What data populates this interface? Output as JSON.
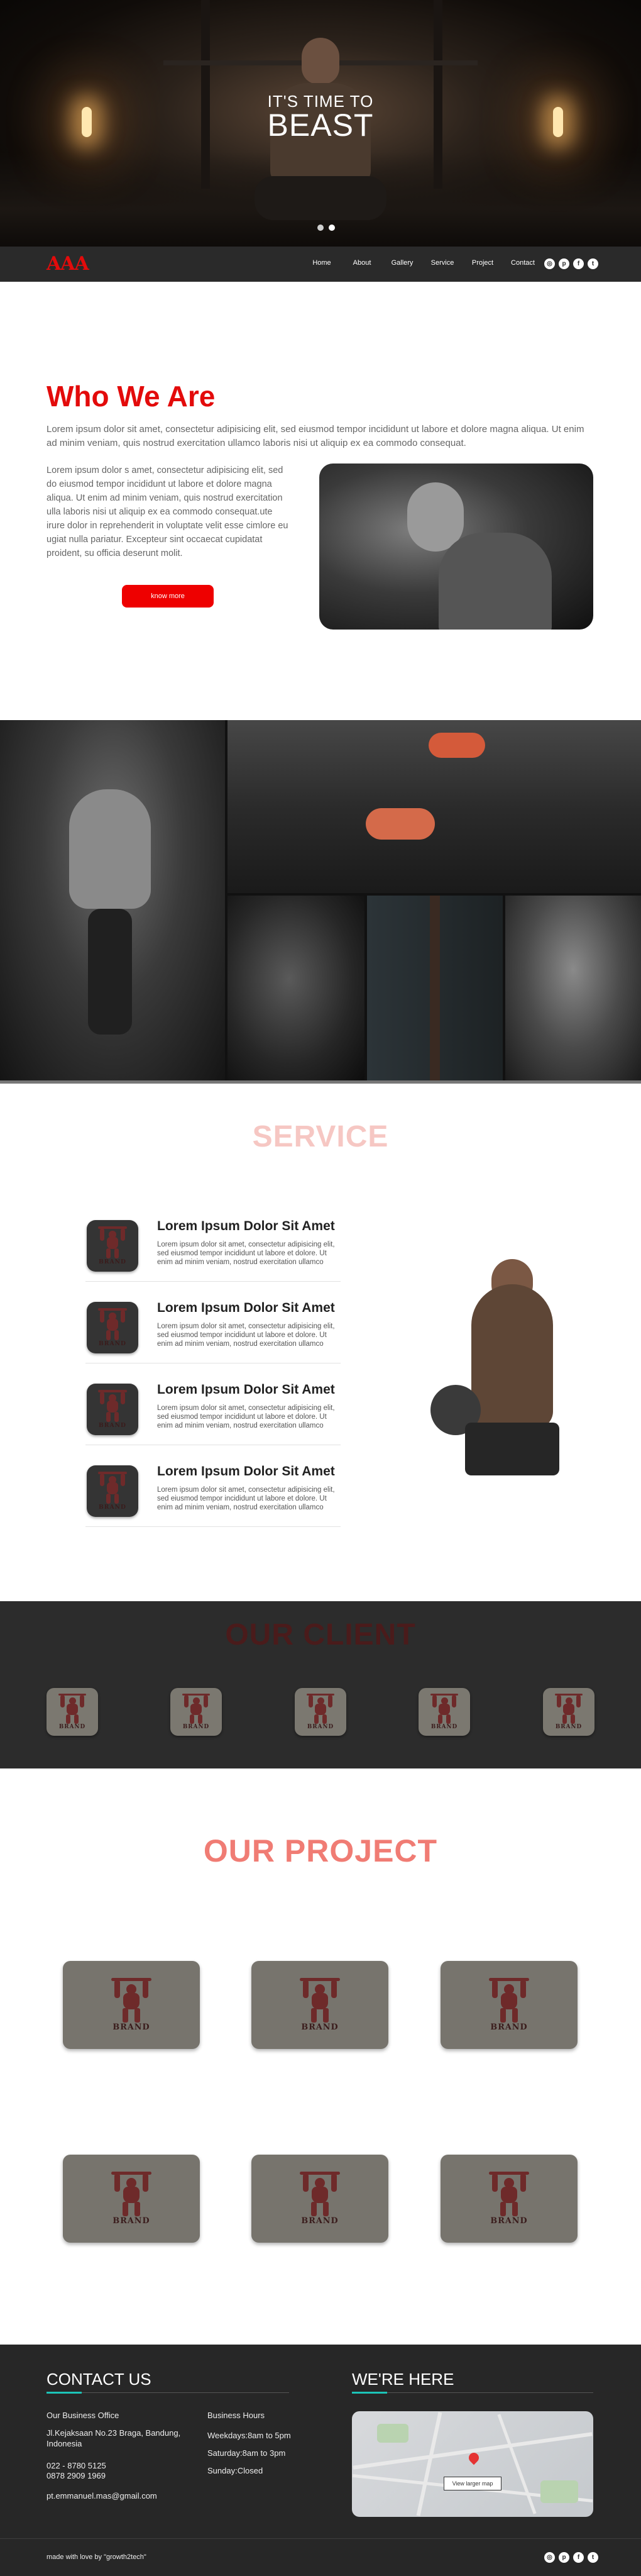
{
  "hero": {
    "subtitle": "IT'S TIME TO",
    "title": "BEAST",
    "slides": 2,
    "active_slide": 2
  },
  "nav": {
    "logo": "AAA",
    "items": [
      "Home",
      "About",
      "Gallery",
      "Service",
      "Project",
      "Contact"
    ],
    "social_icons": [
      "dribbble-icon",
      "pinterest-icon",
      "facebook-icon",
      "twitter-icon"
    ]
  },
  "who": {
    "title": "Who We Are",
    "intro": "Lorem ipsum dolor sit amet, consectetur adipisicing elit, sed eiusmod tempor incididunt ut labore et dolore magna aliqua. Ut enim ad minim veniam, quis nostrud exercitation ullamco laboris nisi ut aliquip ex ea commodo consequat.",
    "body": "Lorem ipsum dolor s amet, consectetur adipisicing elit, sed do eiusmod tempor incididunt ut labore et dolore magna aliqua. Ut enim ad minim veniam, quis nostrud exercitation ulla laboris nisi ut aliquip ex ea commodo consequat.ute irure dolor in reprehenderit in voluptate velit esse cimlore eu ugiat nulla pariatur. Excepteur sint occaecat cupidatat proident, su officia deserunt molit.",
    "button_label": "know more"
  },
  "service": {
    "title": "SERVICE",
    "items": [
      {
        "heading": "Lorem Ipsum Dolor Sit Amet",
        "desc": "Lorem ipsum dolor sit amet, consectetur adipisicing elit, sed eiusmod tempor incididunt ut labore et dolore. Ut enim ad minim veniam, nostrud exercitation ullamco"
      },
      {
        "heading": "Lorem Ipsum Dolor Sit Amet",
        "desc": "Lorem ipsum dolor sit amet, consectetur adipisicing elit, sed eiusmod tempor incididunt ut labore et dolore. Ut enim ad minim veniam, nostrud exercitation ullamco"
      },
      {
        "heading": "Lorem Ipsum Dolor Sit Amet",
        "desc": "Lorem ipsum dolor sit amet, consectetur adipisicing elit, sed eiusmod tempor incididunt ut labore et dolore. Ut enim ad minim veniam, nostrud exercitation ullamco"
      },
      {
        "heading": "Lorem Ipsum Dolor Sit Amet",
        "desc": "Lorem ipsum dolor sit amet, consectetur adipisicing elit, sed eiusmod tempor incididunt ut labore et dolore. Ut enim ad minim veniam, nostrud exercitation ullamco"
      }
    ]
  },
  "brand_word": "BRAND",
  "client": {
    "title": "OUR CLIENT",
    "count": 5
  },
  "project": {
    "title": "OUR PROJECT",
    "count": 6
  },
  "footer": {
    "contact_title": "CONTACT US",
    "map_title": "WE'RE HERE",
    "office_label": "Our Business Office",
    "address": "Jl.Kejaksaan No.23 Braga, Bandung, Indonesia",
    "phone1": "022 - 8780 5125",
    "phone2": "0878 2909 1969",
    "email": "pt.emmanuel.mas@gmail.com",
    "hours_label": "Business Hours",
    "hours_weekdays": "Weekdays:8am to 5pm",
    "hours_saturday": "Saturday:8am to 3pm",
    "hours_sunday": "Sunday:Closed",
    "map_label": "View larger map",
    "made_with": "made with love by \"growth2tech\"",
    "social_icons": [
      "dribbble-icon",
      "pinterest-icon",
      "facebook-icon",
      "twitter-icon"
    ]
  },
  "colors": {
    "accent_red": "#e30b0b",
    "service_title": "#f6c7c3",
    "project_title": "#f07c74",
    "footer_accent": "#1cc4b8",
    "dark": "#2a2a2a"
  }
}
